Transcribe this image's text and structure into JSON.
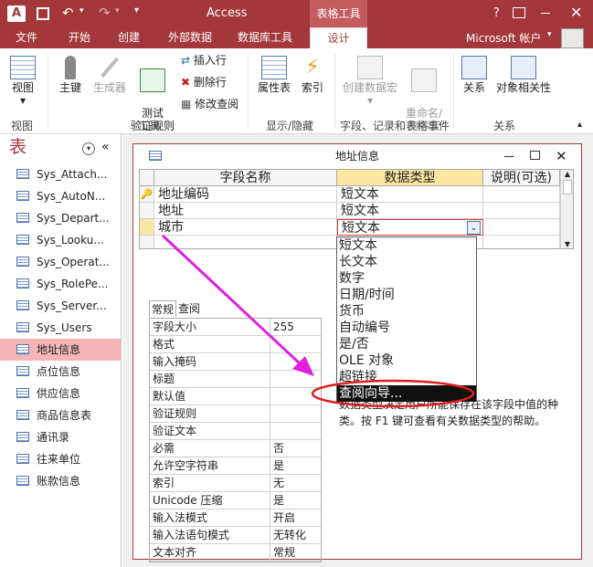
{
  "app": {
    "logo": "A",
    "title": "Access",
    "context_tab": "表格工具",
    "help": "?",
    "account": "Microsoft 帐户"
  },
  "tabs": [
    "文件",
    "开始",
    "创建",
    "外部数据",
    "数据库工具",
    "设计"
  ],
  "ribbon": {
    "view": "视图",
    "view_group": "视图",
    "primary_key": "主键",
    "builder": "生成器",
    "test_rules": "测试\n验证规则",
    "insert_rows": "插入行",
    "delete_rows": "删除行",
    "modify_lookups": "修改查阅",
    "tools_group": "工具",
    "property_sheet": "属性表",
    "indexes": "索引",
    "showhide_group": "显示/隐藏",
    "create_macros": "创建数据宏",
    "rename_macro": "重命名/\n删除宏",
    "macro_group": "字段、记录和表格事件",
    "relationships": "关系",
    "object_deps": "对象相关性",
    "rel_group": "关系"
  },
  "nav": {
    "header": "表",
    "items": [
      "Sys_Attach...",
      "Sys_AutoN...",
      "Sys_Depart...",
      "Sys_Looku...",
      "Sys_Operat...",
      "Sys_RolePe...",
      "Sys_Server...",
      "Sys_Users",
      "地址信息",
      "点位信息",
      "供应信息",
      "商品信息表",
      "通讯录",
      "往来单位",
      "账款信息"
    ],
    "selected": 8
  },
  "window": {
    "title": "地址信息"
  },
  "grid": {
    "headers": [
      "字段名称",
      "数据类型",
      "说明(可选)"
    ],
    "rows": [
      {
        "name": "地址编码",
        "type": "短文本",
        "key": true
      },
      {
        "name": "地址",
        "type": "短文本"
      },
      {
        "name": "城市",
        "type": "短文本",
        "current": true
      }
    ]
  },
  "dropdown": {
    "options": [
      "短文本",
      "长文本",
      "数字",
      "日期/时间",
      "货币",
      "自动编号",
      "是/否",
      "OLE 对象",
      "超链接",
      "查阅向导..."
    ],
    "highlighted": 9
  },
  "props": {
    "tabs": [
      "常规",
      "查阅"
    ],
    "rows": [
      {
        "n": "字段大小",
        "v": "255"
      },
      {
        "n": "格式",
        "v": ""
      },
      {
        "n": "输入掩码",
        "v": ""
      },
      {
        "n": "标题",
        "v": ""
      },
      {
        "n": "默认值",
        "v": ""
      },
      {
        "n": "验证规则",
        "v": ""
      },
      {
        "n": "验证文本",
        "v": ""
      },
      {
        "n": "必需",
        "v": "否"
      },
      {
        "n": "允许空字符串",
        "v": "是"
      },
      {
        "n": "索引",
        "v": "无"
      },
      {
        "n": "Unicode 压缩",
        "v": "是"
      },
      {
        "n": "输入法模式",
        "v": "开启"
      },
      {
        "n": "输入法语句模式",
        "v": "无转化"
      },
      {
        "n": "文本对齐",
        "v": "常规"
      }
    ]
  },
  "help": "数据类型决定用户所能保存在该字段中值的种类。按 F1 键可查看有关数据类型的帮助。",
  "colors": {
    "accent": "#a4373a",
    "annotation": "#e020e0",
    "highlight_ring": "#e02020"
  }
}
